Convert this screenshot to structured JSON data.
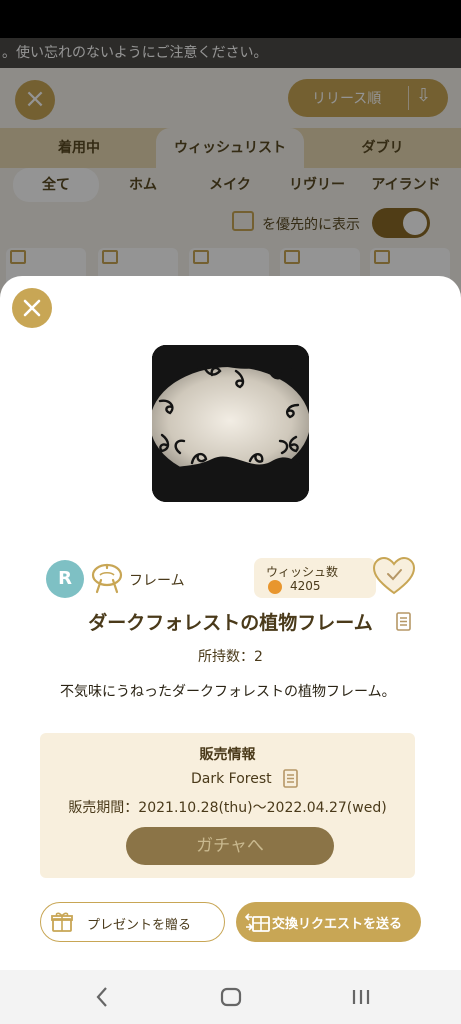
{
  "notice": {
    "text": "。使い忘れのないようにご注意ください。"
  },
  "background": {
    "sort_label": "リリース順",
    "tabs": [
      "着用中",
      "ウィッシュリスト",
      "ダブリ"
    ],
    "subtabs": [
      "全て",
      "ホム",
      "メイク",
      "リヴリー",
      "アイランド"
    ],
    "filter_label": "を優先的に表示",
    "filter_on": true
  },
  "item": {
    "rarity": "R",
    "category": "フレーム",
    "wish_label": "ウィッシュ数",
    "wish_count": "4205",
    "title": "ダークフォレストの植物フレーム",
    "owned": "所持数：2",
    "description": "不気味にうねったダークフォレストの植物フレーム。"
  },
  "sale": {
    "heading": "販売情報",
    "name": "Dark Forest",
    "period": "販売期間：2021.10.28(thu)〜2022.04.27(wed)",
    "gacha_button": "ガチャへ"
  },
  "actions": {
    "present_label": "プレゼントを贈る",
    "exchange_label": "交換リクエストを送る"
  },
  "icons": {
    "close": "close-icon",
    "sort": "sort-icon",
    "present": "gift-icon",
    "exchange": "exchange-icon",
    "wish": "heart-icon",
    "copy": "copy-icon",
    "frame": "frame-icon"
  },
  "colors": {
    "accent_gold": "#c8a655",
    "dark_gold": "#8b7447",
    "sale_bg": "#f8efdd",
    "rarity_teal": "#7ec0c4",
    "wish_orange": "#e8962e"
  }
}
